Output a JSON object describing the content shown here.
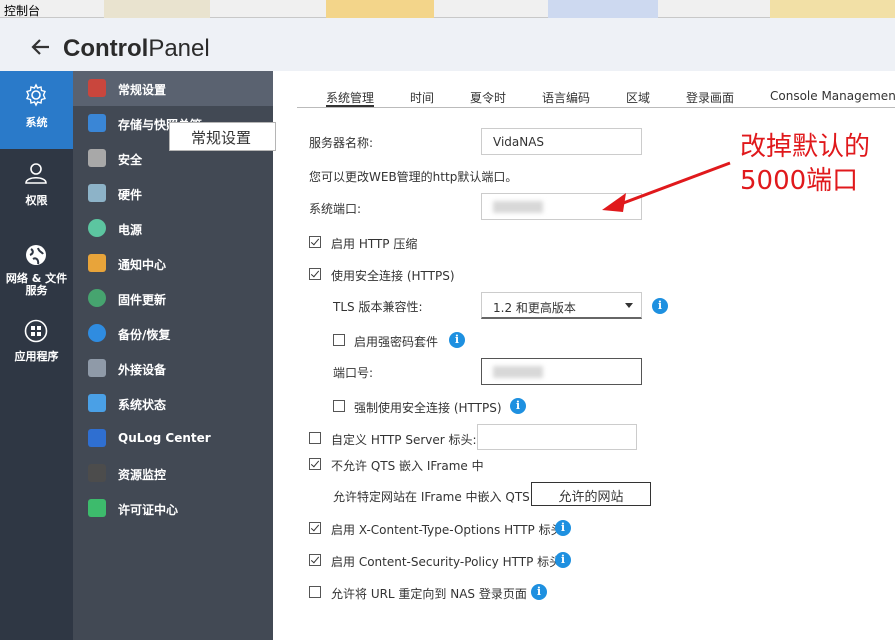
{
  "window": {
    "title": "控制台"
  },
  "header": {
    "title_bold": "Control",
    "title_rest": "Panel"
  },
  "rail": [
    {
      "label": "系统",
      "icon": "gear-icon"
    },
    {
      "label": "权限",
      "icon": "user-icon"
    },
    {
      "label": "网络 & 文件\n服务",
      "icon": "globe-icon"
    },
    {
      "label": "应用程序",
      "icon": "apps-icon"
    }
  ],
  "menu": [
    {
      "label": "常规设置",
      "icon": "general-settings-icon",
      "color": "#c9463d"
    },
    {
      "label": "存储与快照总管",
      "icon": "storage-icon",
      "color": "#3a86d6"
    },
    {
      "label": "安全",
      "icon": "lock-icon",
      "color": "#a8a8a8"
    },
    {
      "label": "硬件",
      "icon": "hardware-icon",
      "color": "#8db3c8"
    },
    {
      "label": "电源",
      "icon": "power-icon",
      "color": "#5cc5a0"
    },
    {
      "label": "通知中心",
      "icon": "notification-icon",
      "color": "#e8a43a"
    },
    {
      "label": "固件更新",
      "icon": "firmware-icon",
      "color": "#46a46f"
    },
    {
      "label": "备份/恢复",
      "icon": "backup-icon",
      "color": "#2f8ce0"
    },
    {
      "label": "外接设备",
      "icon": "external-device-icon",
      "color": "#8f9aa8"
    },
    {
      "label": "系统状态",
      "icon": "system-status-icon",
      "color": "#4aa0e6"
    },
    {
      "label": "QuLog Center",
      "icon": "qulog-icon",
      "color": "#2f6fd1"
    },
    {
      "label": "资源监控",
      "icon": "resource-monitor-icon",
      "color": "#4c4c4c"
    },
    {
      "label": "许可证中心",
      "icon": "license-icon",
      "color": "#3dbb6c"
    }
  ],
  "tooltip": "常规设置",
  "tabs": [
    "系统管理",
    "时间",
    "夏令时",
    "语言编码",
    "区域",
    "登录画面",
    "Console Management"
  ],
  "form": {
    "server_name_label": "服务器名称:",
    "server_name_value": "VidaNAS",
    "http_hint": "您可以更改WEB管理的http默认端口。",
    "system_port_label": "系统端口:",
    "http_compression": "启用 HTTP 压缩",
    "https": "使用安全连接 (HTTPS)",
    "tls_label": "TLS 版本兼容性:",
    "tls_value": "1.2 和更高版本",
    "strong_cipher": "启用强密码套件",
    "port_label": "端口号:",
    "force_https": "强制使用安全连接 (HTTPS)",
    "custom_header": "自定义 HTTP Server 标头:",
    "no_iframe": "不允许 QTS 嵌入 IFrame 中",
    "allow_iframe_label": "允许特定网站在 IFrame 中嵌入 QTS",
    "allowed_sites_button": "允许的网站",
    "xcto": "启用 X-Content-Type-Options HTTP 标头",
    "csp": "启用 Content-Security-Policy HTTP 标头",
    "url_redirect": "允许将 URL 重定向到 NAS 登录页面"
  },
  "annotation": "改掉默认的\n5000端口",
  "colors": {
    "accent": "#2a7ac9",
    "annotation": "#e0191c",
    "rail_bg": "#2f3744",
    "menu_bg": "#424954"
  }
}
